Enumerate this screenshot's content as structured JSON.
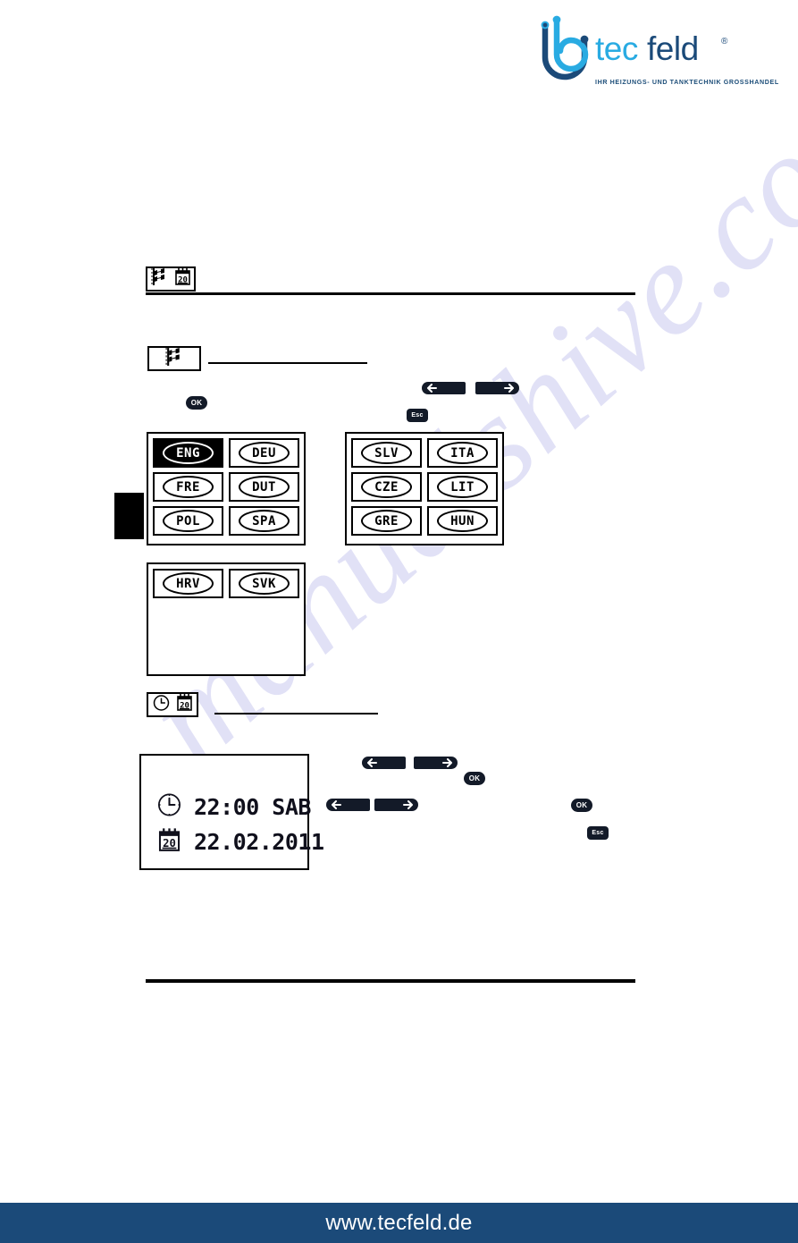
{
  "brand": {
    "name": "tecfeld",
    "name_part_light": "tec",
    "name_part_dark": "feld",
    "registered_mark": "®",
    "tagline": "IHR HEIZUNGS- UND TANKTECHNIK GROSSHANDEL",
    "logo_icon": "tecfeld-b-loop-logo",
    "color_light": "#29ABE2",
    "color_dark": "#1B4A79"
  },
  "watermark": {
    "text": "manualshive.com",
    "color": "#C9C9EF"
  },
  "sections": {
    "language_and_date_heading_icons": [
      "flag-icon",
      "calendar-20-icon"
    ],
    "language_heading_icons": [
      "flag-icon"
    ],
    "datetime_heading_icons": [
      "clock-icon",
      "calendar-20-icon"
    ]
  },
  "buttons": {
    "ok_label": "OK",
    "esc_label": "Esc",
    "arrow_left": "arrow-left-icon",
    "arrow_right": "arrow-right-icon"
  },
  "language_panels": [
    {
      "id": "languages-page-1",
      "cells": [
        {
          "code": "ENG",
          "selected": true
        },
        {
          "code": "DEU",
          "selected": false
        },
        {
          "code": "FRE",
          "selected": false
        },
        {
          "code": "DUT",
          "selected": false
        },
        {
          "code": "POL",
          "selected": false
        },
        {
          "code": "SPA",
          "selected": false
        }
      ]
    },
    {
      "id": "languages-page-2",
      "cells": [
        {
          "code": "SLV",
          "selected": false
        },
        {
          "code": "ITA",
          "selected": false
        },
        {
          "code": "CZE",
          "selected": false
        },
        {
          "code": "LIT",
          "selected": false
        },
        {
          "code": "GRE",
          "selected": false
        },
        {
          "code": "HUN",
          "selected": false
        }
      ]
    },
    {
      "id": "languages-page-3",
      "cells": [
        {
          "code": "HRV",
          "selected": false
        },
        {
          "code": "SVK",
          "selected": false
        }
      ]
    }
  ],
  "datetime_display": {
    "time": "22:00 SAB",
    "date": "22.02.2011",
    "time_icon": "clock-icon",
    "date_icon": "calendar-20-icon",
    "calendar_day": "20"
  },
  "footer": {
    "url": "www.tecfeld.de",
    "background": "#1B4A79"
  }
}
